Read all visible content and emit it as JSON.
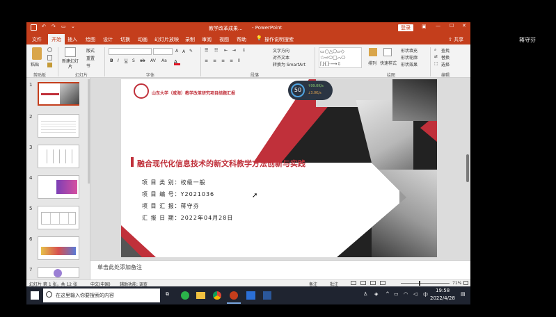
{
  "window": {
    "doc_title": "教学改革成果...",
    "app_name": "PowerPoint",
    "login_label": "登录",
    "share_label": "共享",
    "meeting_user": "蒋守芬"
  },
  "tabs": [
    "文件",
    "开始",
    "插入",
    "绘图",
    "设计",
    "切换",
    "动画",
    "幻灯片放映",
    "录制",
    "审阅",
    "视图",
    "帮助"
  ],
  "tell_me": "操作说明搜索",
  "ribbon": {
    "groups": [
      "剪贴板",
      "幻灯片",
      "字体",
      "段落",
      "绘图",
      "编辑"
    ],
    "paste": "粘贴",
    "new_slide": "新建幻灯片",
    "layout": "版式",
    "reset": "重置",
    "section": "节",
    "text_direction": "文字方向",
    "align_text": "对齐文本",
    "convert_smartart": "转换为 SmartArt",
    "arrange": "排列",
    "quick_styles": "快速样式",
    "shape_fill": "形状填充",
    "shape_outline": "形状轮廓",
    "shape_effects": "形状效果",
    "find": "查找",
    "replace": "替换",
    "select": "选择"
  },
  "thumbnails": [
    "1",
    "2",
    "3",
    "4",
    "5",
    "6",
    "7"
  ],
  "slide": {
    "university": "山东大学（威海）教学改革研究项目结题汇报",
    "title": "融合现代化信息技术的新文科教学方法创新与实践",
    "details": [
      "项 目 类 别：校级一般",
      "项 目 编 号：Y2021036",
      "项 目 汇 报：蒋守芬",
      "汇 报 日 期：2022年04月28日"
    ]
  },
  "network_widget": {
    "percent": "50",
    "up": "99.0K/s",
    "down": "3.0K/s"
  },
  "notes_placeholder": "单击此处添加备注",
  "status": {
    "slide_counter": "幻灯片 第 1 张，共 12 张",
    "language": "中文(中国)",
    "accessibility": "辅助功能: 调查",
    "notes_btn": "备注",
    "comments_btn": "批注",
    "zoom": "71%"
  },
  "taskbar": {
    "search_placeholder": "在这里输入你要搜索的内容",
    "time": "19:58",
    "date": "2022/4/28",
    "ime": "中"
  },
  "colors": {
    "accent": "#c43e1c",
    "slide_red": "#c0303a",
    "taskbar": "#1f2430"
  }
}
